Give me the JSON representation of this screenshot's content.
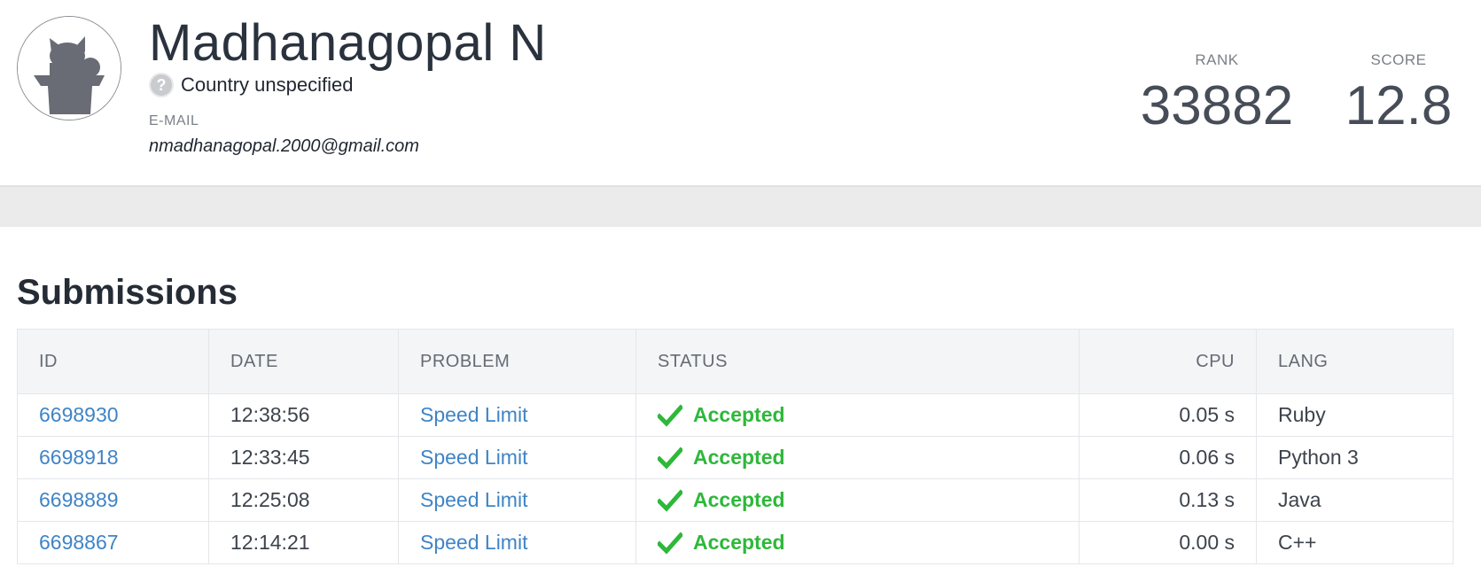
{
  "profile": {
    "name": "Madhanagopal N",
    "country": "Country unspecified",
    "country_flag_glyph": "?",
    "email_label": "E-MAIL",
    "email": "nmadhanagopal.2000@gmail.com"
  },
  "stats": {
    "rank_label": "RANK",
    "rank_value": "33882",
    "score_label": "SCORE",
    "score_value": "12.8"
  },
  "submissions": {
    "title": "Submissions",
    "columns": {
      "id": "ID",
      "date": "DATE",
      "problem": "PROBLEM",
      "status": "STATUS",
      "cpu": "CPU",
      "lang": "LANG"
    },
    "rows": [
      {
        "id": "6698930",
        "date": "12:38:56",
        "problem": "Speed Limit",
        "status": "Accepted",
        "cpu": "0.05 s",
        "lang": "Ruby"
      },
      {
        "id": "6698918",
        "date": "12:33:45",
        "problem": "Speed Limit",
        "status": "Accepted",
        "cpu": "0.06 s",
        "lang": "Python 3"
      },
      {
        "id": "6698889",
        "date": "12:25:08",
        "problem": "Speed Limit",
        "status": "Accepted",
        "cpu": "0.13 s",
        "lang": "Java"
      },
      {
        "id": "6698867",
        "date": "12:14:21",
        "problem": "Speed Limit",
        "status": "Accepted",
        "cpu": "0.00 s",
        "lang": "C++"
      }
    ]
  },
  "colors": {
    "link": "#3f84c6",
    "accepted": "#2eb83a",
    "header_bg": "#f4f5f7"
  },
  "icons": {
    "avatar": "default-avatar-icon",
    "country": "question-mark-icon",
    "status": "checkmark-icon"
  }
}
